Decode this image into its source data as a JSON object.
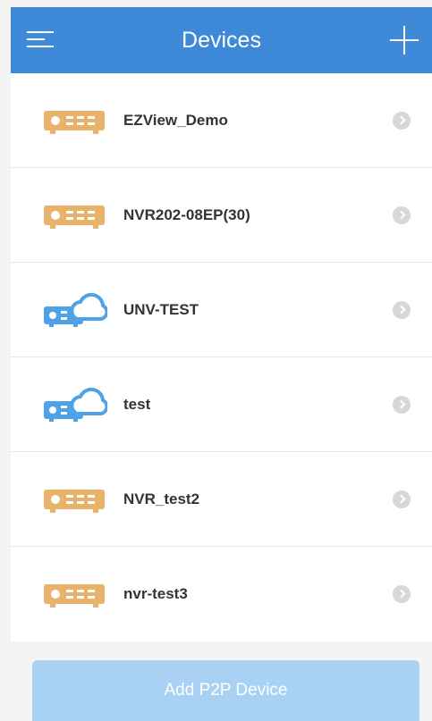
{
  "header": {
    "title": "Devices",
    "menu_icon": "hamburger-menu-icon",
    "add_icon": "plus-icon"
  },
  "devices": [
    {
      "name": "EZView_Demo",
      "icon": "nvr-icon"
    },
    {
      "name": "NVR202-08EP(30)",
      "icon": "nvr-icon"
    },
    {
      "name": "UNV-TEST",
      "icon": "cloud-nvr-icon"
    },
    {
      "name": "test",
      "icon": "cloud-nvr-icon"
    },
    {
      "name": "NVR_test2",
      "icon": "nvr-icon"
    },
    {
      "name": "nvr-test3",
      "icon": "nvr-icon"
    }
  ],
  "footer": {
    "add_p2p_label": "Add P2P Device"
  },
  "colors": {
    "header": "#3f89d9",
    "nvr_icon": "#e8b26a",
    "cloud_icon": "#4ea3e8",
    "button": "#a9d1f3"
  }
}
